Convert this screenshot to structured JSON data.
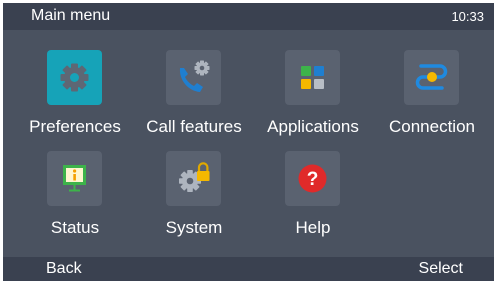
{
  "header": {
    "title": "Main menu",
    "time": "10:33"
  },
  "menu": {
    "items": [
      {
        "label": "Preferences",
        "icon": "preferences-gear-icon",
        "selected": true
      },
      {
        "label": "Call features",
        "icon": "call-features-phone-gear-icon",
        "selected": false
      },
      {
        "label": "Applications",
        "icon": "applications-grid-icon",
        "selected": false
      },
      {
        "label": "Connection",
        "icon": "connection-link-icon",
        "selected": false
      },
      {
        "label": "Status",
        "icon": "status-info-screen-icon",
        "selected": false
      },
      {
        "label": "System",
        "icon": "system-gear-lock-icon",
        "selected": false
      },
      {
        "label": "Help",
        "icon": "help-question-icon",
        "selected": false
      }
    ]
  },
  "softkeys": {
    "left": "Back",
    "right": "Select"
  },
  "colors": {
    "background": "#4a5260",
    "bar": "#3a4150",
    "tile": "#5a6270",
    "selected_tile": "#16a3b8",
    "help_red": "#e02a2a",
    "status_green": "#3db34a"
  }
}
